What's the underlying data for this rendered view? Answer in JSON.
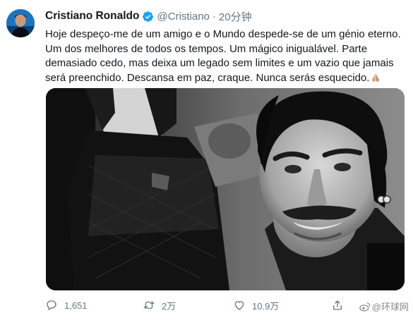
{
  "author": {
    "name": "Cristiano Ronaldo",
    "handle": "@Cristiano",
    "separator": "·",
    "time": "20分钟",
    "verified": true
  },
  "tweet": {
    "text": "Hoje despeço-me de um amigo e o Mundo despede-se de um génio eterno. Um dos melhores de todos os tempos. Um mágico inigualável. Parte demasiado cedo, mas deixa um legado sem limites e um vazio que jamais será preenchido. Descansa em paz, craque. Nunca serás esquecido.",
    "emoji": "praying-hands"
  },
  "media": {
    "type": "black-and-white photo of two men side by side"
  },
  "actions": {
    "reply_count": "1,651",
    "retweet_count": "2万",
    "like_count": "10.9万"
  },
  "watermark": {
    "text": "@环球网"
  },
  "colors": {
    "verified": "#1da1f2",
    "muted": "#657786",
    "text": "#14171a"
  },
  "icons": [
    "avatar",
    "verified-badge-icon",
    "reply-icon",
    "retweet-icon",
    "like-icon",
    "share-icon",
    "weibo-icon"
  ]
}
